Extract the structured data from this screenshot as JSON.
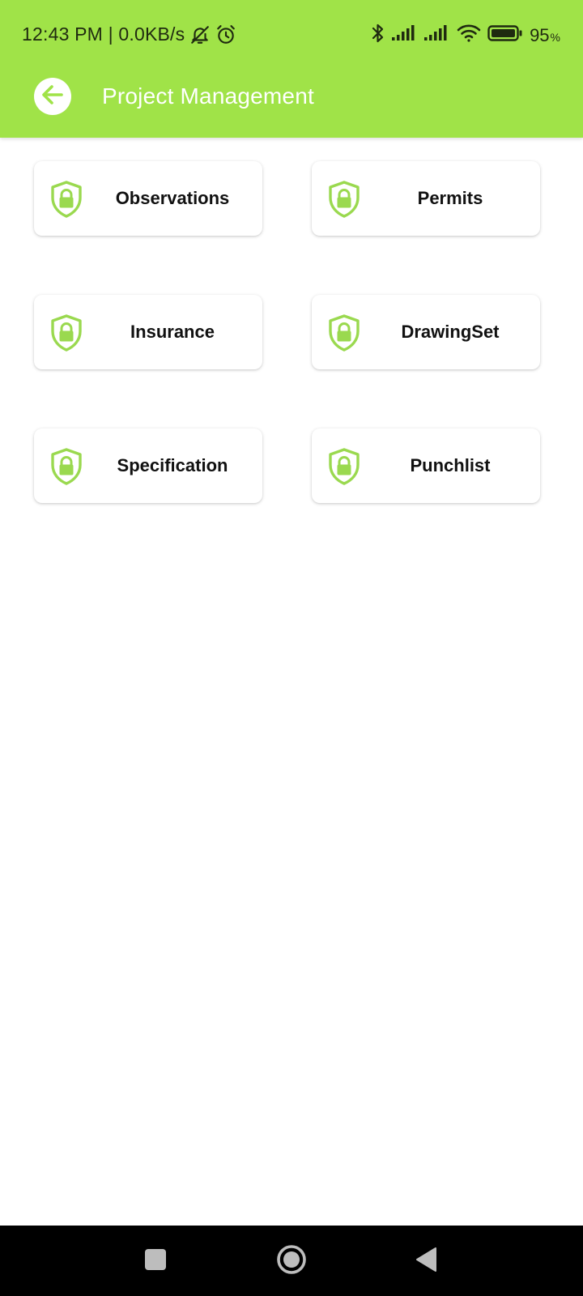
{
  "status_bar": {
    "time_speed": "12:43 PM | 0.0KB/s",
    "battery_percent": "95",
    "battery_unit": "%",
    "icons": [
      "bell-off-icon",
      "alarm-icon",
      "bluetooth-icon",
      "signal-icon",
      "signal-icon",
      "wifi-icon",
      "battery-icon"
    ]
  },
  "toolbar": {
    "title": "Project Management",
    "back_icon": "arrow-left-icon"
  },
  "modules": [
    {
      "label": "Observations",
      "icon": "shield-lock-icon"
    },
    {
      "label": "Permits",
      "icon": "shield-lock-icon"
    },
    {
      "label": "Insurance",
      "icon": "shield-lock-icon"
    },
    {
      "label": "DrawingSet",
      "icon": "shield-lock-icon"
    },
    {
      "label": "Specification",
      "icon": "shield-lock-icon"
    },
    {
      "label": "Punchlist",
      "icon": "shield-lock-icon"
    }
  ],
  "nav_bar": {
    "icons": [
      "recents-square-icon",
      "home-circle-icon",
      "back-triangle-icon"
    ]
  },
  "colors": {
    "accent_green": "#a0e348",
    "icon_green": "#9ad94f",
    "text_dark": "#111111"
  }
}
